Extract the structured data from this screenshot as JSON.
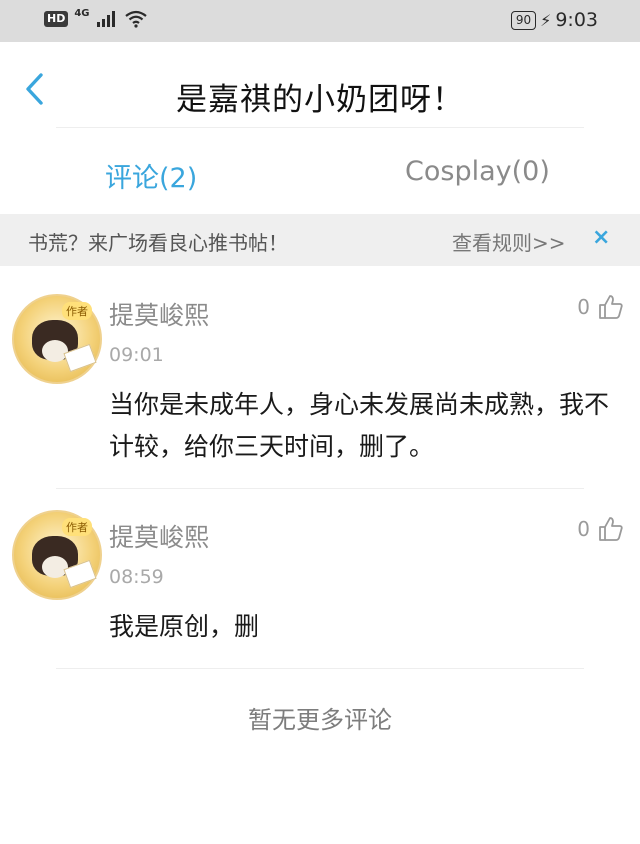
{
  "status_bar": {
    "hd": "HD",
    "network": "4G",
    "battery": "90",
    "time": "9:03"
  },
  "header": {
    "title": "是嘉祺的小奶团呀！"
  },
  "tabs": [
    {
      "label": "评论(2)",
      "active": true
    },
    {
      "label": "Cosplay(0)",
      "active": false
    }
  ],
  "banner": {
    "text": "书荒？来广场看良心推书帖！",
    "link": "查看规则>>",
    "close": "×"
  },
  "comments": [
    {
      "username": "提莫峻熙",
      "time": "09:01",
      "likes": "0",
      "badge": "作者",
      "content": "当你是未成年人，身心未发展尚未成熟，我不计较，给你三天时间，删了。"
    },
    {
      "username": "提莫峻熙",
      "time": "08:59",
      "likes": "0",
      "badge": "作者",
      "content": "我是原创，删"
    }
  ],
  "footer": {
    "no_more": "暂无更多评论"
  },
  "colors": {
    "accent": "#3aa6dd",
    "banner_bg": "#efefef",
    "status_bg": "#dcdcdc"
  }
}
